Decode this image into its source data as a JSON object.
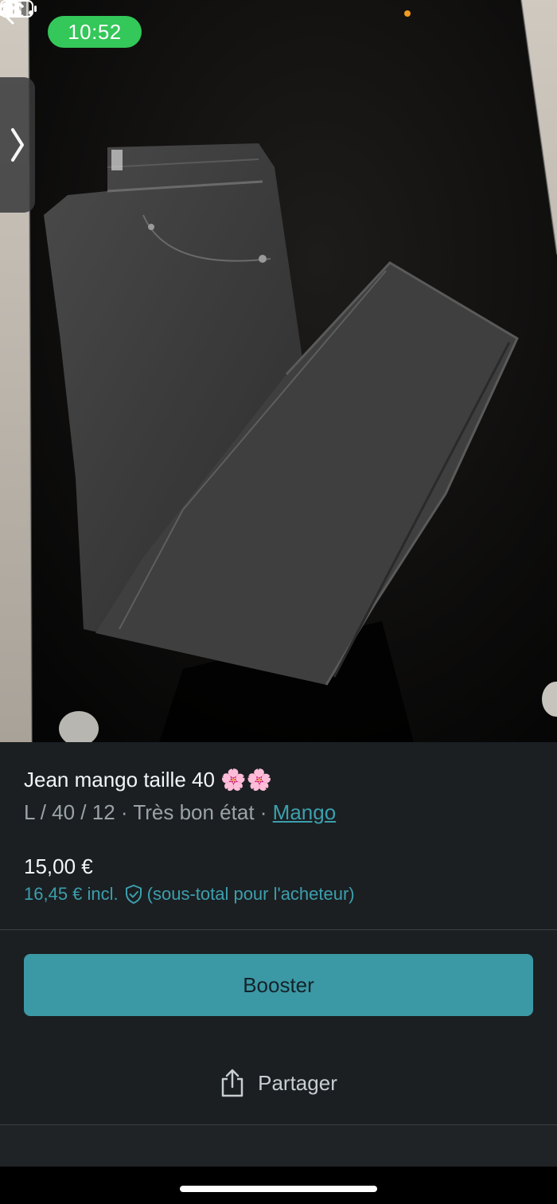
{
  "status_bar": {
    "time": "10:52"
  },
  "listing": {
    "title": "Jean mango taille 40 🌸🌸",
    "details": "L / 40 / 12 · Très bon état · ",
    "brand": "Mango",
    "price": "15,00 €",
    "price_incl_prefix": "16,45 € incl.",
    "price_incl_suffix": "(sous-total pour l'acheteur)"
  },
  "actions": {
    "booster_label": "Booster",
    "share_label": "Partager"
  },
  "colors": {
    "accent": "#3b99a5",
    "link": "#3c9fad",
    "panel_bg": "#1b1f22",
    "status_green": "#34c759"
  },
  "icons": [
    "back-arrow-icon",
    "more-options-icon",
    "chevron-right-icon",
    "shield-check-icon",
    "share-icon",
    "signal-icon",
    "wifi-icon",
    "battery-icon"
  ]
}
